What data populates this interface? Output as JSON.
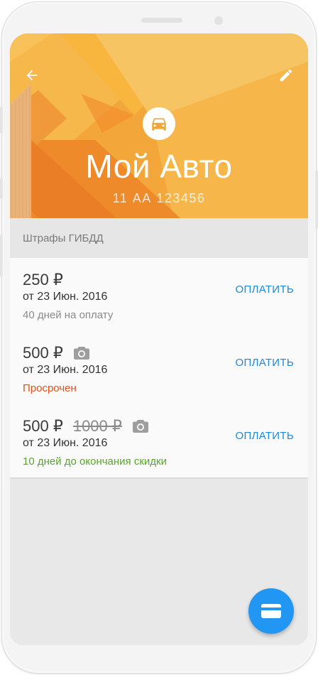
{
  "header": {
    "title": "Мой Авто",
    "plate": "11 АА 123456",
    "back_icon": "arrow-back-icon",
    "edit_icon": "pencil-icon",
    "car_icon": "car-icon"
  },
  "section": {
    "title": "Штрафы ГИБДД"
  },
  "fines": [
    {
      "amount": "250 ₽",
      "old_amount": "",
      "has_photo": false,
      "date": "от 23 Июн. 2016",
      "status": "40 дней на оплату",
      "status_color": "#8a8a8a",
      "pay_label": "ОПЛАТИТЬ"
    },
    {
      "amount": "500 ₽",
      "old_amount": "",
      "has_photo": true,
      "date": "от 23 Июн. 2016",
      "status": "Просрочен",
      "status_color": "#e0521a",
      "pay_label": "ОПЛАТИТЬ"
    },
    {
      "amount": "500 ₽",
      "old_amount": "1000 ₽",
      "has_photo": true,
      "date": "от 23 Июн. 2016",
      "status": "10 дней до окончания скидки",
      "status_color": "#5ba52b",
      "pay_label": "ОПЛАТИТЬ"
    }
  ],
  "fab": {
    "icon": "credit-card-icon"
  },
  "colors": {
    "accent": "#1e88d9",
    "fab": "#2196f3",
    "header": "#f0a63a"
  }
}
